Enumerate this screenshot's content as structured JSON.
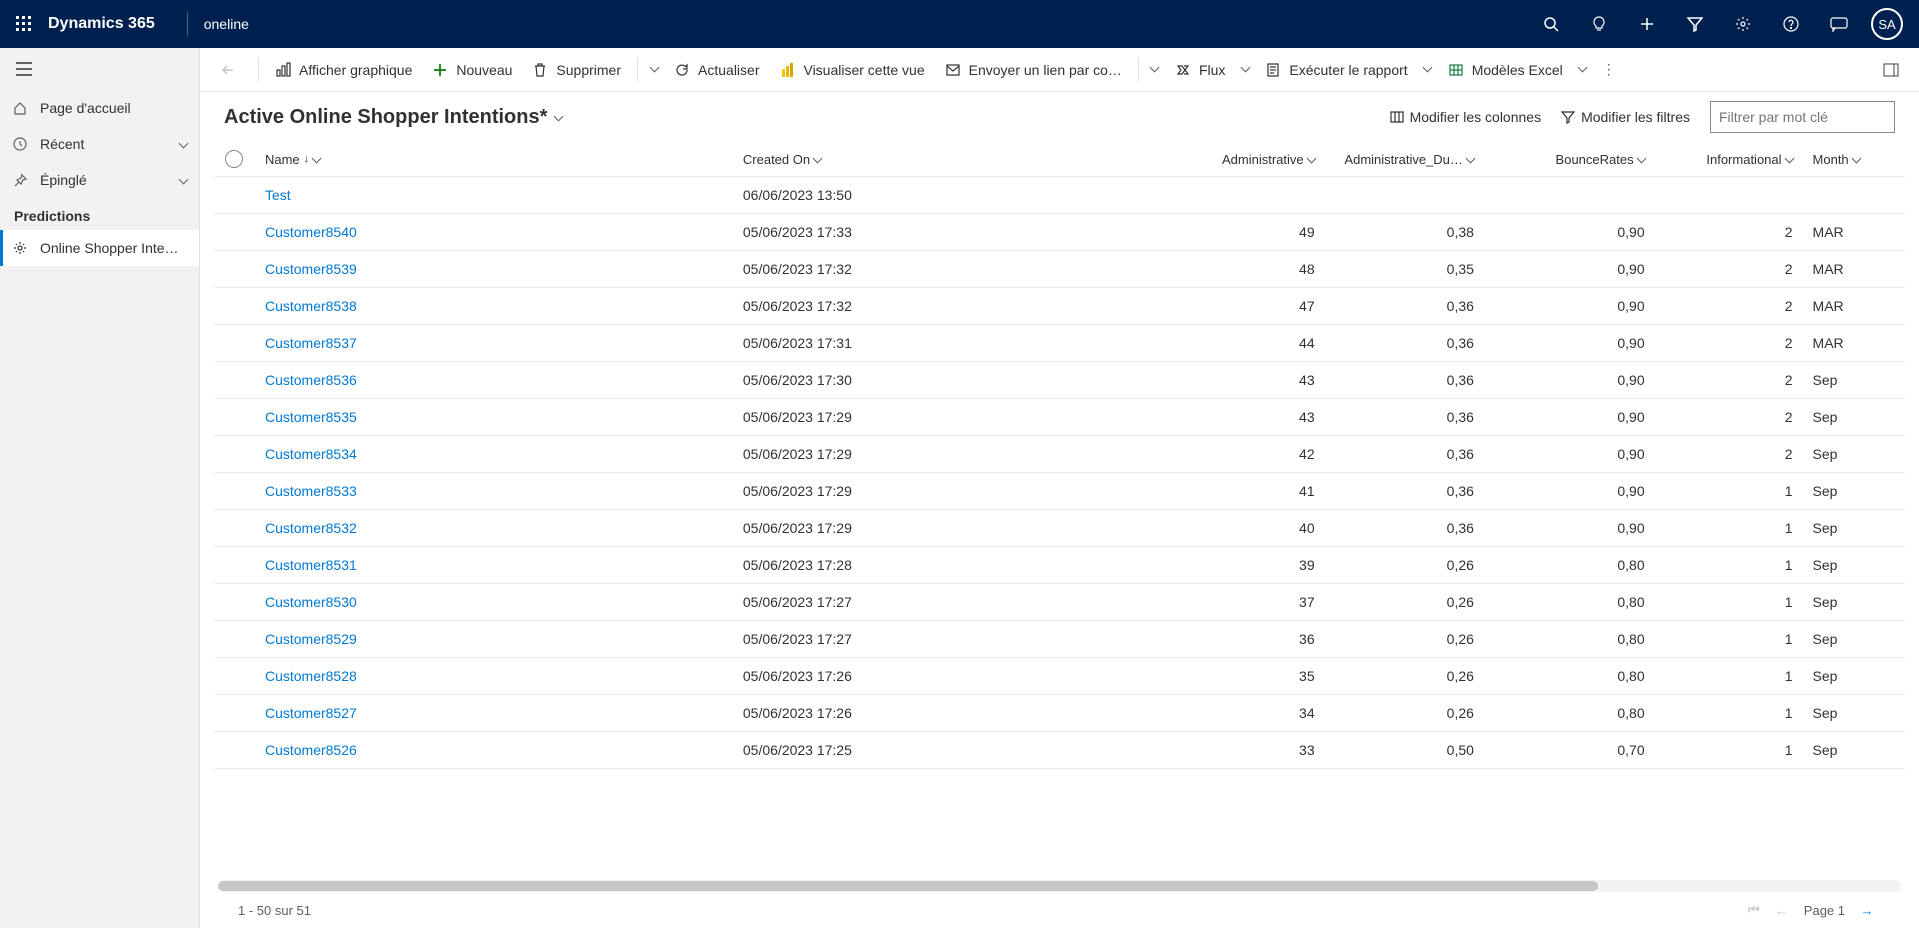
{
  "top": {
    "brand": "Dynamics 365",
    "app": "oneline",
    "avatar": "SA"
  },
  "sidebar": {
    "home": "Page d'accueil",
    "recent": "Récent",
    "pinned": "Épinglé",
    "group": "Predictions",
    "entity": "Online Shopper Inte…"
  },
  "cmd": {
    "chart": "Afficher graphique",
    "new": "Nouveau",
    "delete": "Supprimer",
    "refresh": "Actualiser",
    "visualize": "Visualiser cette vue",
    "email": "Envoyer un lien par co…",
    "flow": "Flux",
    "report": "Exécuter le rapport",
    "excel": "Modèles Excel"
  },
  "view": {
    "title": "Active Online Shopper Intentions*",
    "edit_cols": "Modifier les colonnes",
    "edit_filters": "Modifier les filtres",
    "filter_placeholder": "Filtrer par mot clé"
  },
  "columns": {
    "name": "Name",
    "created": "Created On",
    "admin": "Administrative",
    "admin_du": "Administrative_Du…",
    "bounce": "BounceRates",
    "info": "Informational",
    "month": "Month"
  },
  "rows": [
    {
      "name": "Test",
      "created": "06/06/2023 13:50",
      "admin": "",
      "admin_du": "",
      "bounce": "",
      "info": "",
      "month": ""
    },
    {
      "name": "Customer8540",
      "created": "05/06/2023 17:33",
      "admin": "49",
      "admin_du": "0,38",
      "bounce": "0,90",
      "info": "2",
      "month": "MAR"
    },
    {
      "name": "Customer8539",
      "created": "05/06/2023 17:32",
      "admin": "48",
      "admin_du": "0,35",
      "bounce": "0,90",
      "info": "2",
      "month": "MAR"
    },
    {
      "name": "Customer8538",
      "created": "05/06/2023 17:32",
      "admin": "47",
      "admin_du": "0,36",
      "bounce": "0,90",
      "info": "2",
      "month": "MAR"
    },
    {
      "name": "Customer8537",
      "created": "05/06/2023 17:31",
      "admin": "44",
      "admin_du": "0,36",
      "bounce": "0,90",
      "info": "2",
      "month": "MAR"
    },
    {
      "name": "Customer8536",
      "created": "05/06/2023 17:30",
      "admin": "43",
      "admin_du": "0,36",
      "bounce": "0,90",
      "info": "2",
      "month": "Sep"
    },
    {
      "name": "Customer8535",
      "created": "05/06/2023 17:29",
      "admin": "43",
      "admin_du": "0,36",
      "bounce": "0,90",
      "info": "2",
      "month": "Sep"
    },
    {
      "name": "Customer8534",
      "created": "05/06/2023 17:29",
      "admin": "42",
      "admin_du": "0,36",
      "bounce": "0,90",
      "info": "2",
      "month": "Sep"
    },
    {
      "name": "Customer8533",
      "created": "05/06/2023 17:29",
      "admin": "41",
      "admin_du": "0,36",
      "bounce": "0,90",
      "info": "1",
      "month": "Sep"
    },
    {
      "name": "Customer8532",
      "created": "05/06/2023 17:29",
      "admin": "40",
      "admin_du": "0,36",
      "bounce": "0,90",
      "info": "1",
      "month": "Sep"
    },
    {
      "name": "Customer8531",
      "created": "05/06/2023 17:28",
      "admin": "39",
      "admin_du": "0,26",
      "bounce": "0,80",
      "info": "1",
      "month": "Sep"
    },
    {
      "name": "Customer8530",
      "created": "05/06/2023 17:27",
      "admin": "37",
      "admin_du": "0,26",
      "bounce": "0,80",
      "info": "1",
      "month": "Sep"
    },
    {
      "name": "Customer8529",
      "created": "05/06/2023 17:27",
      "admin": "36",
      "admin_du": "0,26",
      "bounce": "0,80",
      "info": "1",
      "month": "Sep"
    },
    {
      "name": "Customer8528",
      "created": "05/06/2023 17:26",
      "admin": "35",
      "admin_du": "0,26",
      "bounce": "0,80",
      "info": "1",
      "month": "Sep"
    },
    {
      "name": "Customer8527",
      "created": "05/06/2023 17:26",
      "admin": "34",
      "admin_du": "0,26",
      "bounce": "0,80",
      "info": "1",
      "month": "Sep"
    },
    {
      "name": "Customer8526",
      "created": "05/06/2023 17:25",
      "admin": "33",
      "admin_du": "0,50",
      "bounce": "0,70",
      "info": "1",
      "month": "Sep"
    }
  ],
  "paging": {
    "range": "1 - 50 sur 51",
    "page": "Page 1"
  }
}
